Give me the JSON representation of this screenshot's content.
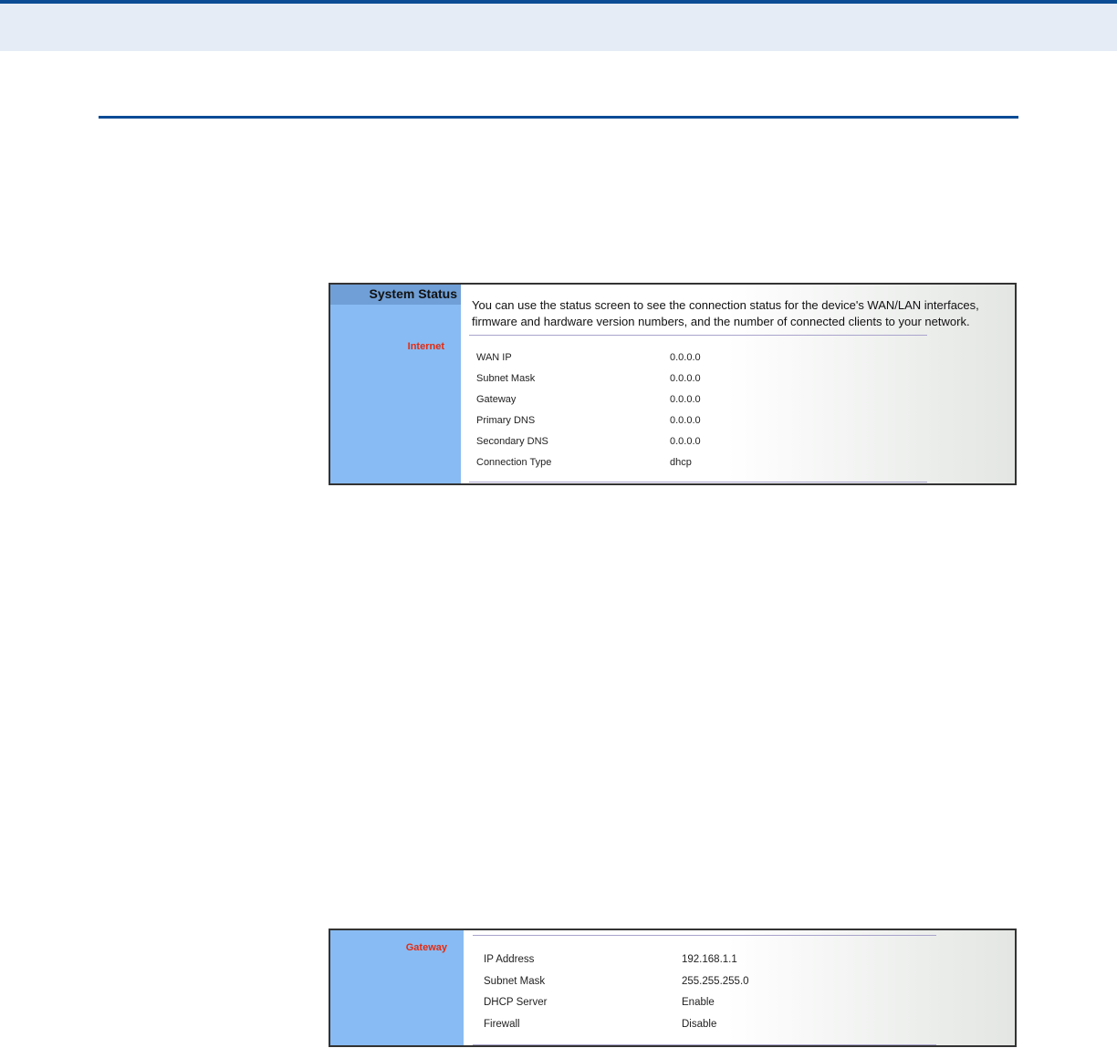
{
  "panel_internet": {
    "title": "System Status",
    "intro": "You can use the status screen to see the connection status for the device's WAN/LAN interfaces, firmware and hardware version numbers, and the number of connected clients to your network.",
    "section_label": "Internet",
    "rows": [
      {
        "label": "WAN IP",
        "value": "0.0.0.0"
      },
      {
        "label": "Subnet Mask",
        "value": "0.0.0.0"
      },
      {
        "label": "Gateway",
        "value": "0.0.0.0"
      },
      {
        "label": "Primary DNS",
        "value": "0.0.0.0"
      },
      {
        "label": "Secondary DNS",
        "value": "0.0.0.0"
      },
      {
        "label": "Connection Type",
        "value": "dhcp"
      }
    ]
  },
  "panel_gateway": {
    "section_label": "Gateway",
    "rows": [
      {
        "label": "IP Address",
        "value": "192.168.1.1"
      },
      {
        "label": "Subnet Mask",
        "value": "255.255.255.0"
      },
      {
        "label": "DHCP Server",
        "value": "Enable"
      },
      {
        "label": "Firewall",
        "value": "Disable"
      }
    ]
  }
}
